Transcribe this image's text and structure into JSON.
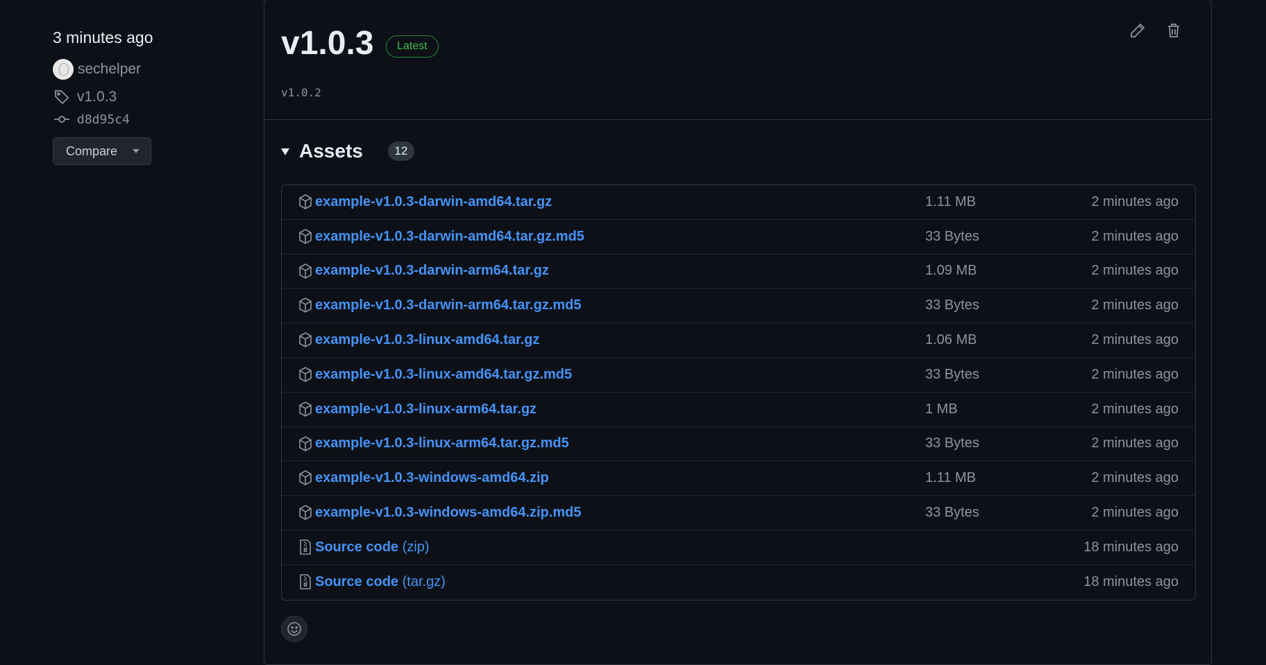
{
  "sidebar": {
    "time": "3 minutes ago",
    "author": "sechelper",
    "tag": "v1.0.3",
    "commit": "d8d95c4",
    "compare_label": "Compare"
  },
  "release": {
    "title": "v1.0.3",
    "badge": "Latest",
    "subtitle": "v1.0.2"
  },
  "assets": {
    "title": "Assets",
    "count": "12",
    "items": [
      {
        "name": "example-v1.0.3-darwin-amd64.tar.gz",
        "size": "1.11 MB",
        "time": "2 minutes ago"
      },
      {
        "name": "example-v1.0.3-darwin-amd64.tar.gz.md5",
        "size": "33 Bytes",
        "time": "2 minutes ago"
      },
      {
        "name": "example-v1.0.3-darwin-arm64.tar.gz",
        "size": "1.09 MB",
        "time": "2 minutes ago"
      },
      {
        "name": "example-v1.0.3-darwin-arm64.tar.gz.md5",
        "size": "33 Bytes",
        "time": "2 minutes ago"
      },
      {
        "name": "example-v1.0.3-linux-amd64.tar.gz",
        "size": "1.06 MB",
        "time": "2 minutes ago"
      },
      {
        "name": "example-v1.0.3-linux-amd64.tar.gz.md5",
        "size": "33 Bytes",
        "time": "2 minutes ago"
      },
      {
        "name": "example-v1.0.3-linux-arm64.tar.gz",
        "size": "1 MB",
        "time": "2 minutes ago"
      },
      {
        "name": "example-v1.0.3-linux-arm64.tar.gz.md5",
        "size": "33 Bytes",
        "time": "2 minutes ago"
      },
      {
        "name": "example-v1.0.3-windows-amd64.zip",
        "size": "1.11 MB",
        "time": "2 minutes ago"
      },
      {
        "name": "example-v1.0.3-windows-amd64.zip.md5",
        "size": "33 Bytes",
        "time": "2 minutes ago"
      }
    ],
    "source": [
      {
        "name": "Source code",
        "ext": "(zip)",
        "time": "18 minutes ago"
      },
      {
        "name": "Source code",
        "ext": "(tar.gz)",
        "time": "18 minutes ago"
      }
    ]
  },
  "colors": {
    "background": "#0d1117",
    "link": "#4493f8",
    "muted": "#8b949e",
    "border": "#30363d",
    "latest_green": "#3fb950"
  },
  "icons": {
    "tag": "tag-icon",
    "commit": "git-commit-icon",
    "edit": "pencil-icon",
    "delete": "trash-icon",
    "package": "package-icon",
    "zip": "file-zip-icon",
    "reaction": "smiley-icon"
  }
}
